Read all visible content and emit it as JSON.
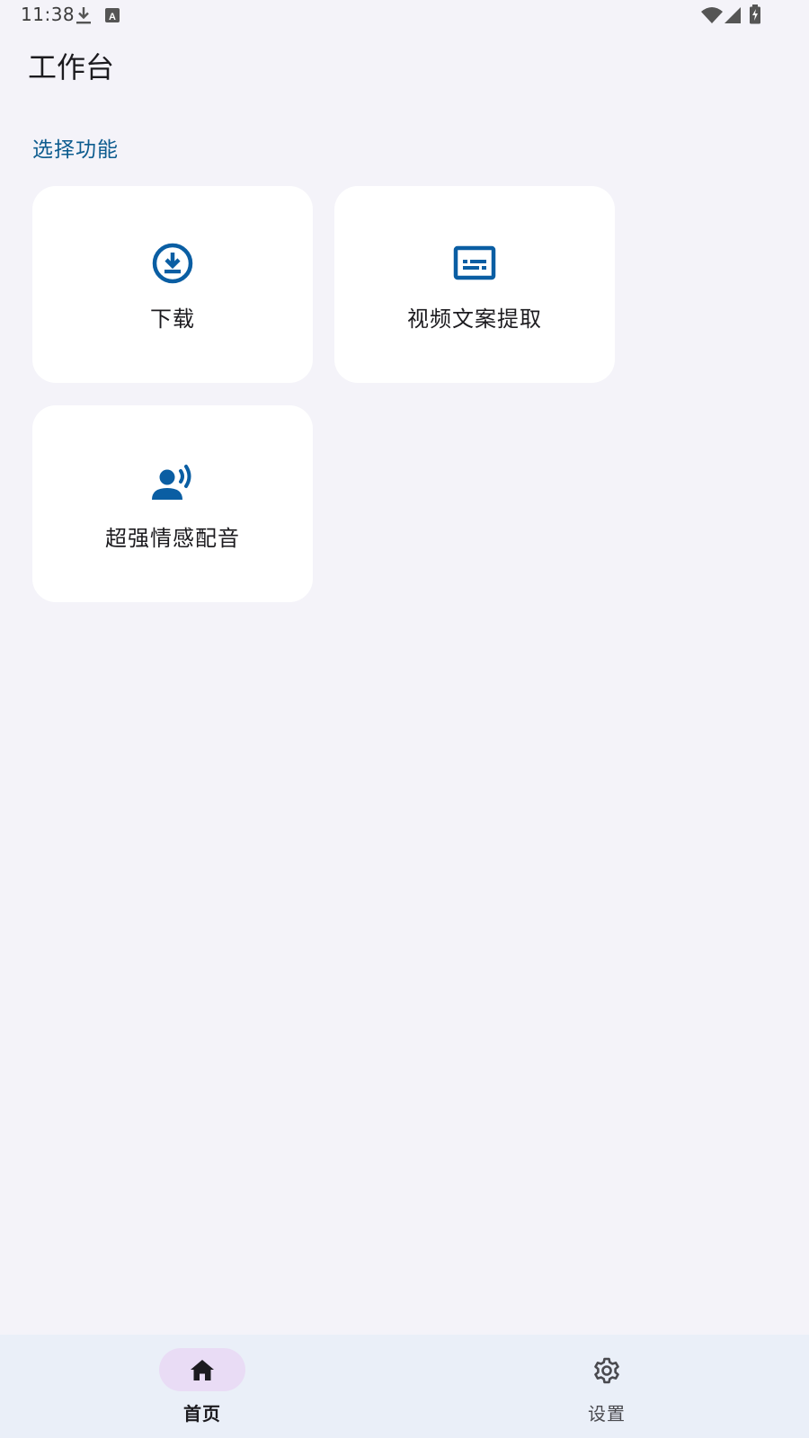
{
  "status_bar": {
    "time": "11:38",
    "icons": [
      "download-icon",
      "keyboard-a-icon",
      "wifi-icon",
      "cell-signal-icon",
      "battery-charging-icon"
    ]
  },
  "header": {
    "title": "工作台"
  },
  "main": {
    "section_title": "选择功能",
    "cards": [
      {
        "label": "下载",
        "icon": "download-circle-icon"
      },
      {
        "label": "视频文案提取",
        "icon": "subtitles-icon"
      },
      {
        "label": "超强情感配音",
        "icon": "voice-over-icon"
      }
    ]
  },
  "bottom_nav": {
    "items": [
      {
        "label": "首页",
        "icon": "home-icon",
        "active": true
      },
      {
        "label": "设置",
        "icon": "settings-icon",
        "active": false
      }
    ]
  },
  "colors": {
    "accent": "#0d5c8f",
    "icon_blue": "#0a5ea3",
    "background": "#f4f3f9",
    "card": "#ffffff",
    "nav_background": "#eaeff8",
    "nav_active_pill": "#e9dcf5"
  }
}
